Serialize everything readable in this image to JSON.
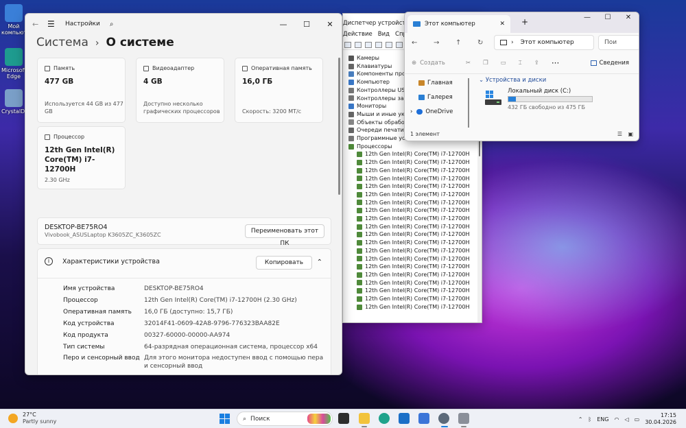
{
  "desktop": {
    "icons": [
      {
        "label": "Мой компьютер",
        "color": "#3a7fd8"
      },
      {
        "label": "Microsoft Edge",
        "color": "#1e9b8f"
      },
      {
        "label": "CrystalDisk",
        "color": "#7a9fc8"
      }
    ]
  },
  "settings": {
    "app_title": "Настройки",
    "crumb": "Система",
    "page_title": "О системе",
    "cards": [
      {
        "label": "Память",
        "value": "477 GB",
        "sub": "Используется 44 GB из 477 GB"
      },
      {
        "label": "Видеоадаптер",
        "value": "4 GB",
        "sub": "Доступно несколько графических процессоров"
      },
      {
        "label": "Оперативная память",
        "value": "16,0 ГБ",
        "sub": "Скорость: 3200 МТ/с"
      },
      {
        "label": "Процессор",
        "value": "12th Gen Intel(R) Core(TM) i7-12700H",
        "sub": "2.30 GHz"
      }
    ],
    "device": {
      "name": "DESKTOP-BE75RO4",
      "model": "Vivobook_ASUSLaptop K3605ZC_K3605ZC",
      "rename_button": "Переименовать этот ПК"
    },
    "specs": {
      "header": "Характеристики устройства",
      "copy_button": "Копировать",
      "rows": [
        {
          "key": "Имя устройства",
          "value": "DESKTOP-BE75RO4"
        },
        {
          "key": "Процессор",
          "value": "12th Gen Intel(R) Core(TM) i7-12700H (2.30 GHz)"
        },
        {
          "key": "Оперативная память",
          "value": "16,0 ГБ (доступно: 15,7 ГБ)"
        },
        {
          "key": "Код устройства",
          "value": "32014F41-0609-42A8-9796-776323BAA82E"
        },
        {
          "key": "Код продукта",
          "value": "00327-60000-00000-AA974"
        },
        {
          "key": "Тип системы",
          "value": "64-разрядная операционная система, процессор x64"
        },
        {
          "key": "Перо и сенсорный ввод",
          "value": "Для этого монитора недоступен ввод с помощью пера и сенсорный ввод"
        }
      ]
    }
  },
  "device_manager": {
    "title": "Диспетчер устройств",
    "menu": [
      "Действие",
      "Вид",
      "Справка"
    ],
    "categories": [
      {
        "label": "Камеры",
        "color": "#555"
      },
      {
        "label": "Клавиатуры",
        "color": "#666"
      },
      {
        "label": "Компоненты программного обеспечения",
        "color": "#4a7fc0"
      },
      {
        "label": "Компьютер",
        "color": "#3a78c8"
      },
      {
        "label": "Контроллеры USB",
        "color": "#777"
      },
      {
        "label": "Контроллеры запоминающих устройств",
        "color": "#777"
      },
      {
        "label": "Мониторы",
        "color": "#3a78c8"
      },
      {
        "label": "Мыши и иные указывающие устройства",
        "color": "#666"
      },
      {
        "label": "Объекты обработки звука",
        "color": "#888"
      },
      {
        "label": "Очереди печати",
        "color": "#666"
      },
      {
        "label": "Программные устройства",
        "color": "#777"
      },
      {
        "label": "Процессоры",
        "color": "#4f8a3a"
      }
    ],
    "processor_item": "12th Gen Intel(R) Core(TM) i7-12700H",
    "processor_count": 20
  },
  "explorer": {
    "tab_title": "Этот компьютер",
    "path": "Этот компьютер",
    "search_placeholder": "Пои",
    "create": "Создать",
    "details": "Сведения",
    "sidebar": [
      {
        "label": "Главная",
        "color": "#c8862a"
      },
      {
        "label": "Галерея",
        "color": "#2a7fd4"
      },
      {
        "label": "OneDrive",
        "color": "#1e6fd9"
      }
    ],
    "group": "Устройства и диски",
    "drive": {
      "name": "Локальный диск (C:)",
      "free": "432 ГБ свободно из 475 ГБ",
      "used_fraction": 0.09
    },
    "status": "1 элемент"
  },
  "taskbar": {
    "temp": "27°C",
    "weather": "Partly sunny",
    "search": "Поиск",
    "lang": "ENG",
    "time": "17:15",
    "date": "30.04.2026"
  }
}
